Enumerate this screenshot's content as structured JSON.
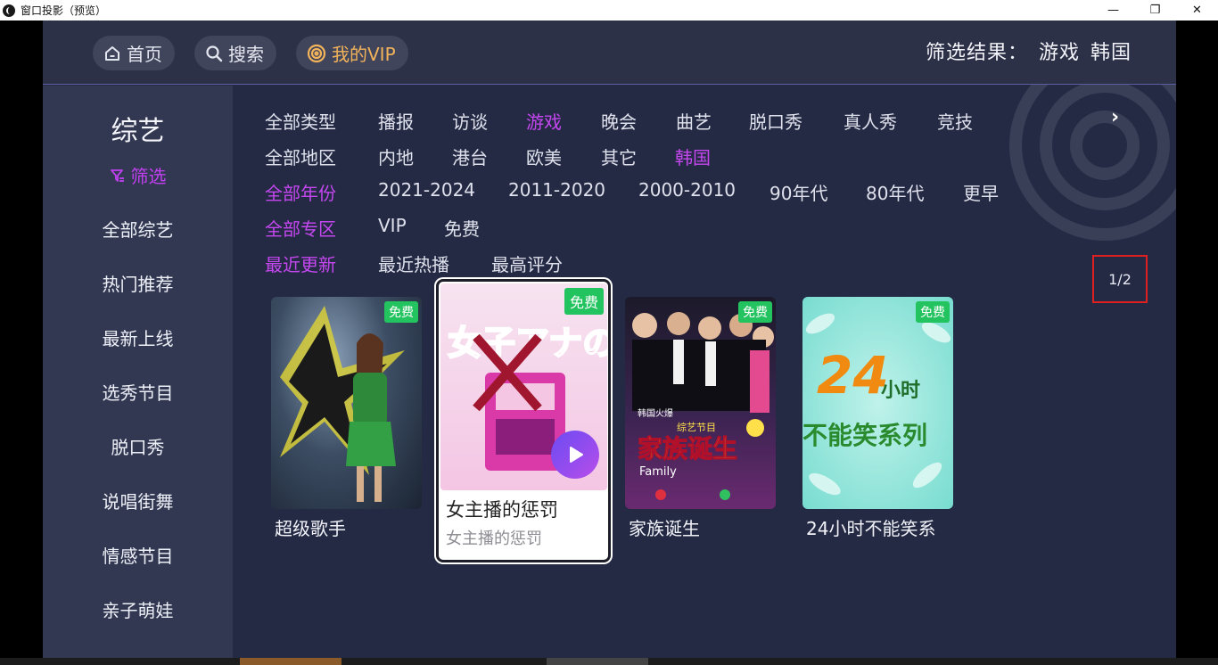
{
  "window": {
    "title": "窗口投影（预览）",
    "min_glyph": "—",
    "max_glyph": "❐",
    "close_glyph": "✕"
  },
  "header": {
    "home_label": "首页",
    "search_label": "搜索",
    "vip_label": "我的VIP",
    "result_label": "筛选结果：",
    "result_values": [
      "游戏",
      "韩国"
    ]
  },
  "sidebar": {
    "title": "综艺",
    "filter_label": "筛选",
    "items": [
      "全部综艺",
      "热门推荐",
      "最新上线",
      "选秀节目",
      "脱口秀",
      "说唱街舞",
      "情感节目",
      "亲子萌娃"
    ]
  },
  "filters": {
    "type": [
      "全部类型",
      "播报",
      "访谈",
      "游戏",
      "晚会",
      "曲艺",
      "脱口秀",
      "真人秀",
      "竞技"
    ],
    "region": [
      "全部地区",
      "内地",
      "港台",
      "欧美",
      "其它",
      "韩国"
    ],
    "year": [
      "全部年份",
      "2021-2024",
      "2011-2020",
      "2000-2010",
      "90年代",
      "80年代",
      "更早"
    ],
    "zone": [
      "全部专区",
      "VIP",
      "免费"
    ],
    "sort": [
      "最近更新",
      "最近热播",
      "最高评分"
    ],
    "more_icon": "chevron-right"
  },
  "pager": "1/2",
  "cards": [
    {
      "title": "超级歌手",
      "badge": "免费"
    },
    {
      "title": "女主播的惩罚",
      "subtitle": "女主播的惩罚",
      "badge": "免费",
      "poster_text": "女子アナの罰"
    },
    {
      "title": "家族诞生",
      "badge": "免费",
      "poster_text": [
        "韩国火爆",
        "综艺节目",
        "家族诞生",
        "Family"
      ]
    },
    {
      "title": "24小时不能笑系",
      "badge": "免费",
      "poster_text": [
        "24",
        "小时",
        "不能笑系列"
      ]
    }
  ],
  "colors": {
    "accent": "#c447f0",
    "badge": "#23c35f",
    "background": "#252a44",
    "vip": "#f2b35a"
  }
}
